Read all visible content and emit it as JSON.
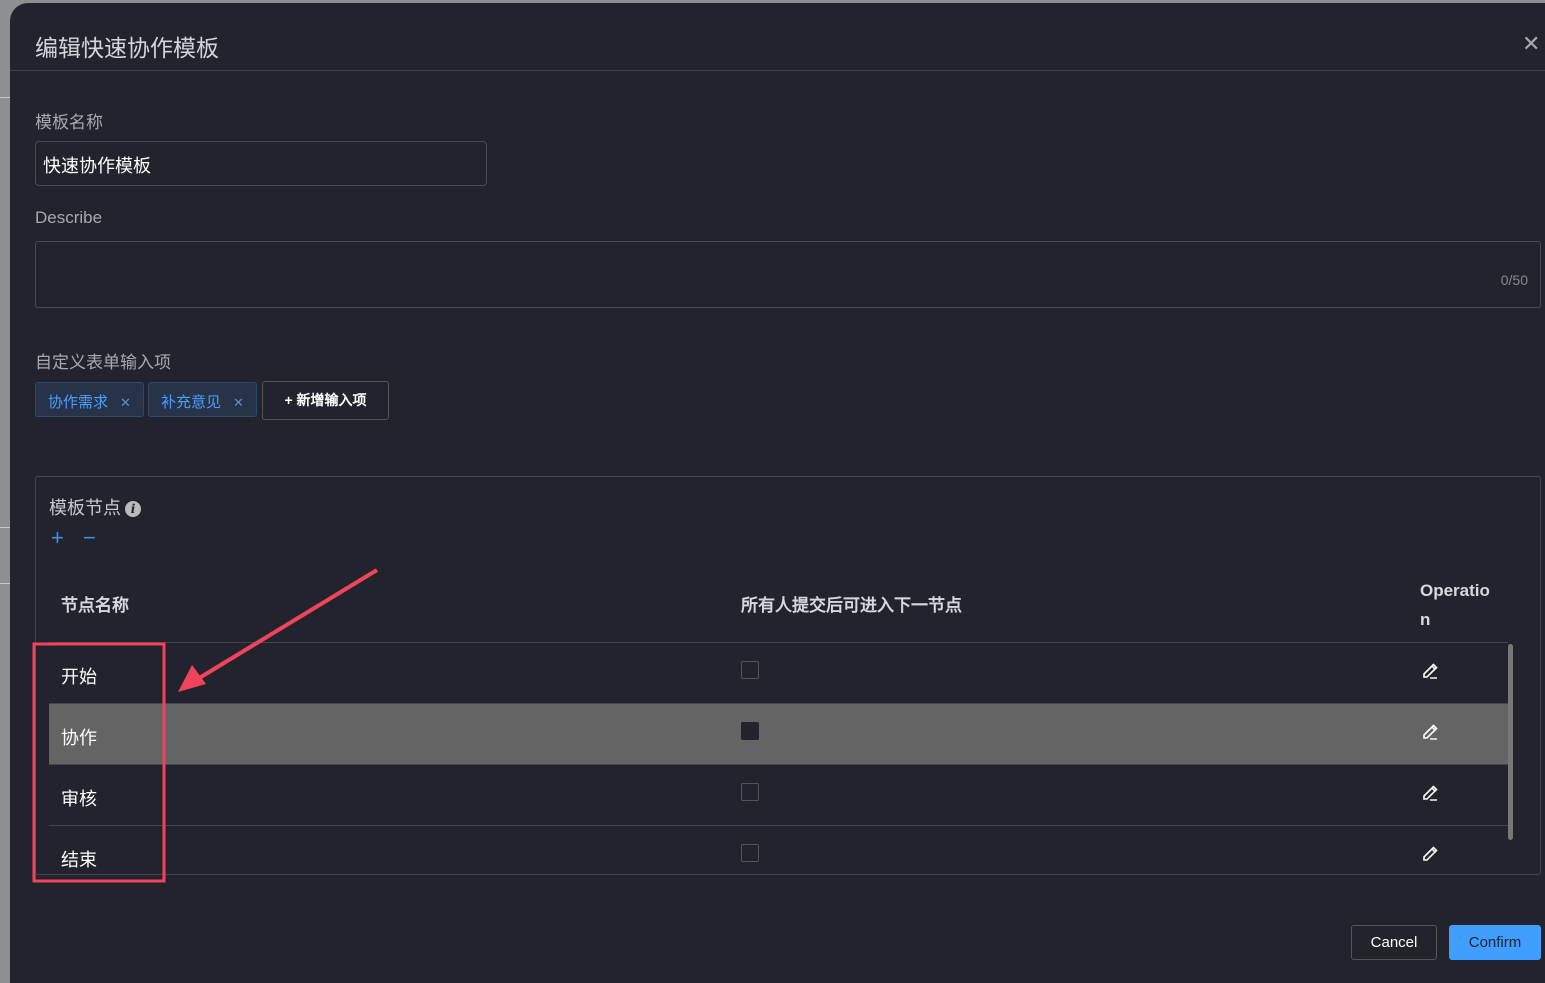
{
  "dialog": {
    "title": "编辑快速协作模板",
    "close_icon": "close-icon"
  },
  "form": {
    "name_label": "模板名称",
    "name_value": "快速协作模板",
    "describe_label": "Describe",
    "describe_value": "",
    "describe_count": "0/50",
    "custom_label": "自定义表单输入项",
    "tags": [
      {
        "label": "协作需求"
      },
      {
        "label": "补充意见"
      }
    ],
    "add_input_label": "+ 新增输入项"
  },
  "nodes": {
    "title": "模板节点",
    "add": "+",
    "remove": "−",
    "columns": {
      "name": "节点名称",
      "all_submit": "所有人提交后可进入下一节点",
      "operation": "Operation"
    },
    "rows": [
      {
        "name": "开始",
        "checked": false
      },
      {
        "name": "协作",
        "checked": true,
        "highlighted": true
      },
      {
        "name": "审核",
        "checked": false
      },
      {
        "name": "结束",
        "checked": false
      }
    ]
  },
  "footer": {
    "cancel": "Cancel",
    "confirm": "Confirm"
  },
  "colors": {
    "accent": "#409eff",
    "annotation": "#f0435c",
    "background": "#23232d"
  }
}
